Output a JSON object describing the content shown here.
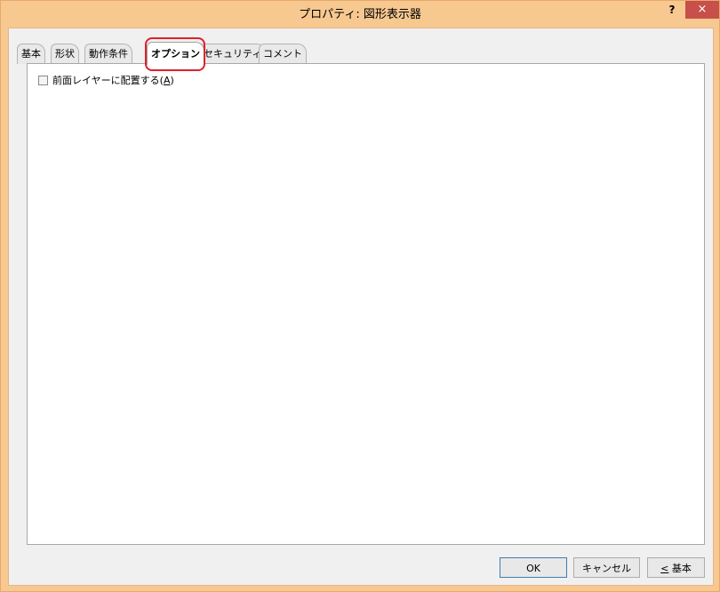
{
  "window": {
    "title": "プロパティ: 図形表示器",
    "help_label": "?",
    "close_label": "×"
  },
  "tabs": [
    {
      "label": "基本"
    },
    {
      "label": "形状"
    },
    {
      "label": "動作条件"
    },
    {
      "label": "オプション",
      "active": true
    },
    {
      "label": "セキュリティ"
    },
    {
      "label": "コメント"
    }
  ],
  "options": {
    "front_layer_label": "前面レイヤーに配置する(",
    "front_layer_accel": "A",
    "front_layer_suffix": ")",
    "front_layer_checked": false
  },
  "buttons": {
    "ok_label": "OK",
    "cancel_label": "キャンセル",
    "basic_accel": "<",
    "basic_label": " 基本"
  },
  "colors": {
    "titlebar": "#f7c890",
    "close_button": "#c7504a",
    "highlight": "#e0202a"
  }
}
